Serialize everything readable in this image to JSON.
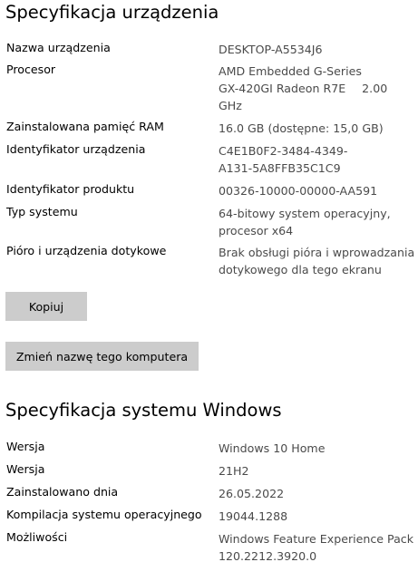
{
  "device_spec": {
    "title": "Specyfikacja urządzenia",
    "rows": [
      {
        "label": "Nazwa urządzenia",
        "lines": [
          "DESKTOP-A5534J6"
        ]
      },
      {
        "label": "Procesor",
        "lines": [
          "AMD Embedded G-Series",
          "GX-420GI Radeon R7E",
          "GHz"
        ],
        "freq": "2.00"
      },
      {
        "label": "Zainstalowana pamięć RAM",
        "lines": [
          "16.0 GB (dostępne: 15,0 GB)"
        ]
      },
      {
        "label": "Identyfikator urządzenia",
        "lines": [
          "C4E1B0F2-3484-4349-",
          "A131-5A8FFB35C1C9"
        ]
      },
      {
        "label": "Identyfikator produktu",
        "lines": [
          "00326-10000-00000-AA591"
        ]
      },
      {
        "label": "Typ systemu",
        "lines": [
          "64-bitowy system operacyjny,",
          "procesor x64"
        ]
      },
      {
        "label": "Pióro i urządzenia dotykowe",
        "lines": [
          "Brak obsługi pióra i wprowadzania",
          "dotykowego dla tego ekranu"
        ]
      }
    ],
    "copy_button": "Kopiuj",
    "rename_button": "Zmień nazwę tego komputera"
  },
  "windows_spec": {
    "title": "Specyfikacja systemu Windows",
    "rows": [
      {
        "label": "Wersja",
        "lines": [
          "Windows 10 Home"
        ]
      },
      {
        "label": "Wersja",
        "lines": [
          "21H2"
        ]
      },
      {
        "label": "Zainstalowano dnia",
        "lines": [
          "26.05.2022"
        ]
      },
      {
        "label": "Kompilacja systemu operacyjnego",
        "lines": [
          "19044.1288"
        ]
      },
      {
        "label": "Możliwości",
        "lines": [
          "Windows Feature Experience Pack",
          "120.2212.3920.0"
        ]
      }
    ]
  }
}
